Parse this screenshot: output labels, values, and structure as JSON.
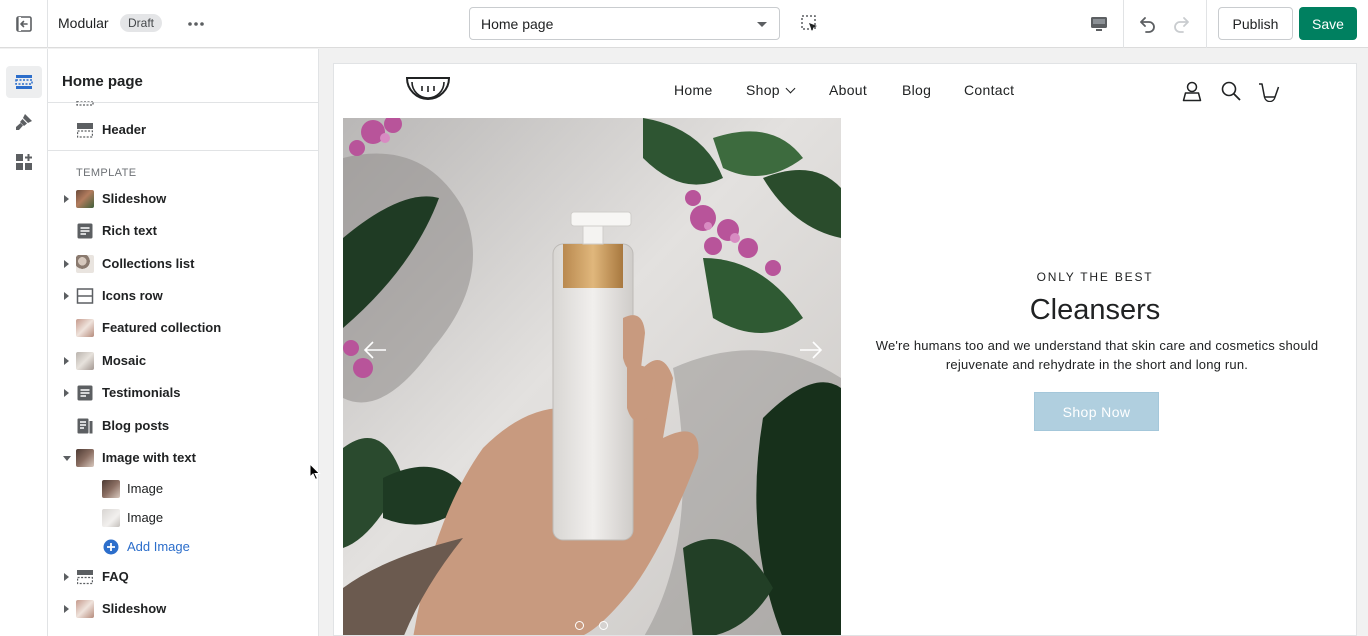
{
  "topbar": {
    "theme_name": "Modular",
    "status_badge": "Draft",
    "page_selector": "Home page",
    "publish_label": "Publish",
    "save_label": "Save",
    "accent_color": "#008060"
  },
  "rail": {
    "items": [
      {
        "icon": "sections-icon",
        "active": true
      },
      {
        "icon": "theme-settings-brush-icon",
        "active": false
      },
      {
        "icon": "app-blocks-icon",
        "active": false
      }
    ]
  },
  "sidebar": {
    "title": "Home page",
    "header_item": "Header",
    "template_label": "TEMPLATE",
    "items": [
      {
        "label": "Slideshow",
        "expandable": true
      },
      {
        "label": "Rich text",
        "expandable": false
      },
      {
        "label": "Collections list",
        "expandable": true
      },
      {
        "label": "Icons row",
        "expandable": true
      },
      {
        "label": "Featured collection",
        "expandable": false
      },
      {
        "label": "Mosaic",
        "expandable": true
      },
      {
        "label": "Testimonials",
        "expandable": true
      },
      {
        "label": "Blog posts",
        "expandable": false
      },
      {
        "label": "Image with text",
        "expandable": true,
        "expanded": true
      },
      {
        "label": "Image",
        "child": true
      },
      {
        "label": "Image",
        "child": true
      },
      {
        "label": "Add Image",
        "child": true,
        "add": true
      },
      {
        "label": "FAQ",
        "expandable": true
      },
      {
        "label": "Slideshow",
        "expandable": true
      }
    ]
  },
  "preview": {
    "nav": [
      "Home",
      "Shop",
      "About",
      "Blog",
      "Contact"
    ],
    "header_icons": [
      "account-icon",
      "search-icon",
      "cart-icon"
    ],
    "hero": {
      "eyebrow": "ONLY THE BEST",
      "title": "Cleansers",
      "description": "We're humans too and we understand that skin care and cosmetics should rejuvenate and rehydrate in the short and long run.",
      "button_label": "Shop Now",
      "button_color": "#b0cfdf",
      "slides_total": 2,
      "active_slide": 1
    }
  }
}
